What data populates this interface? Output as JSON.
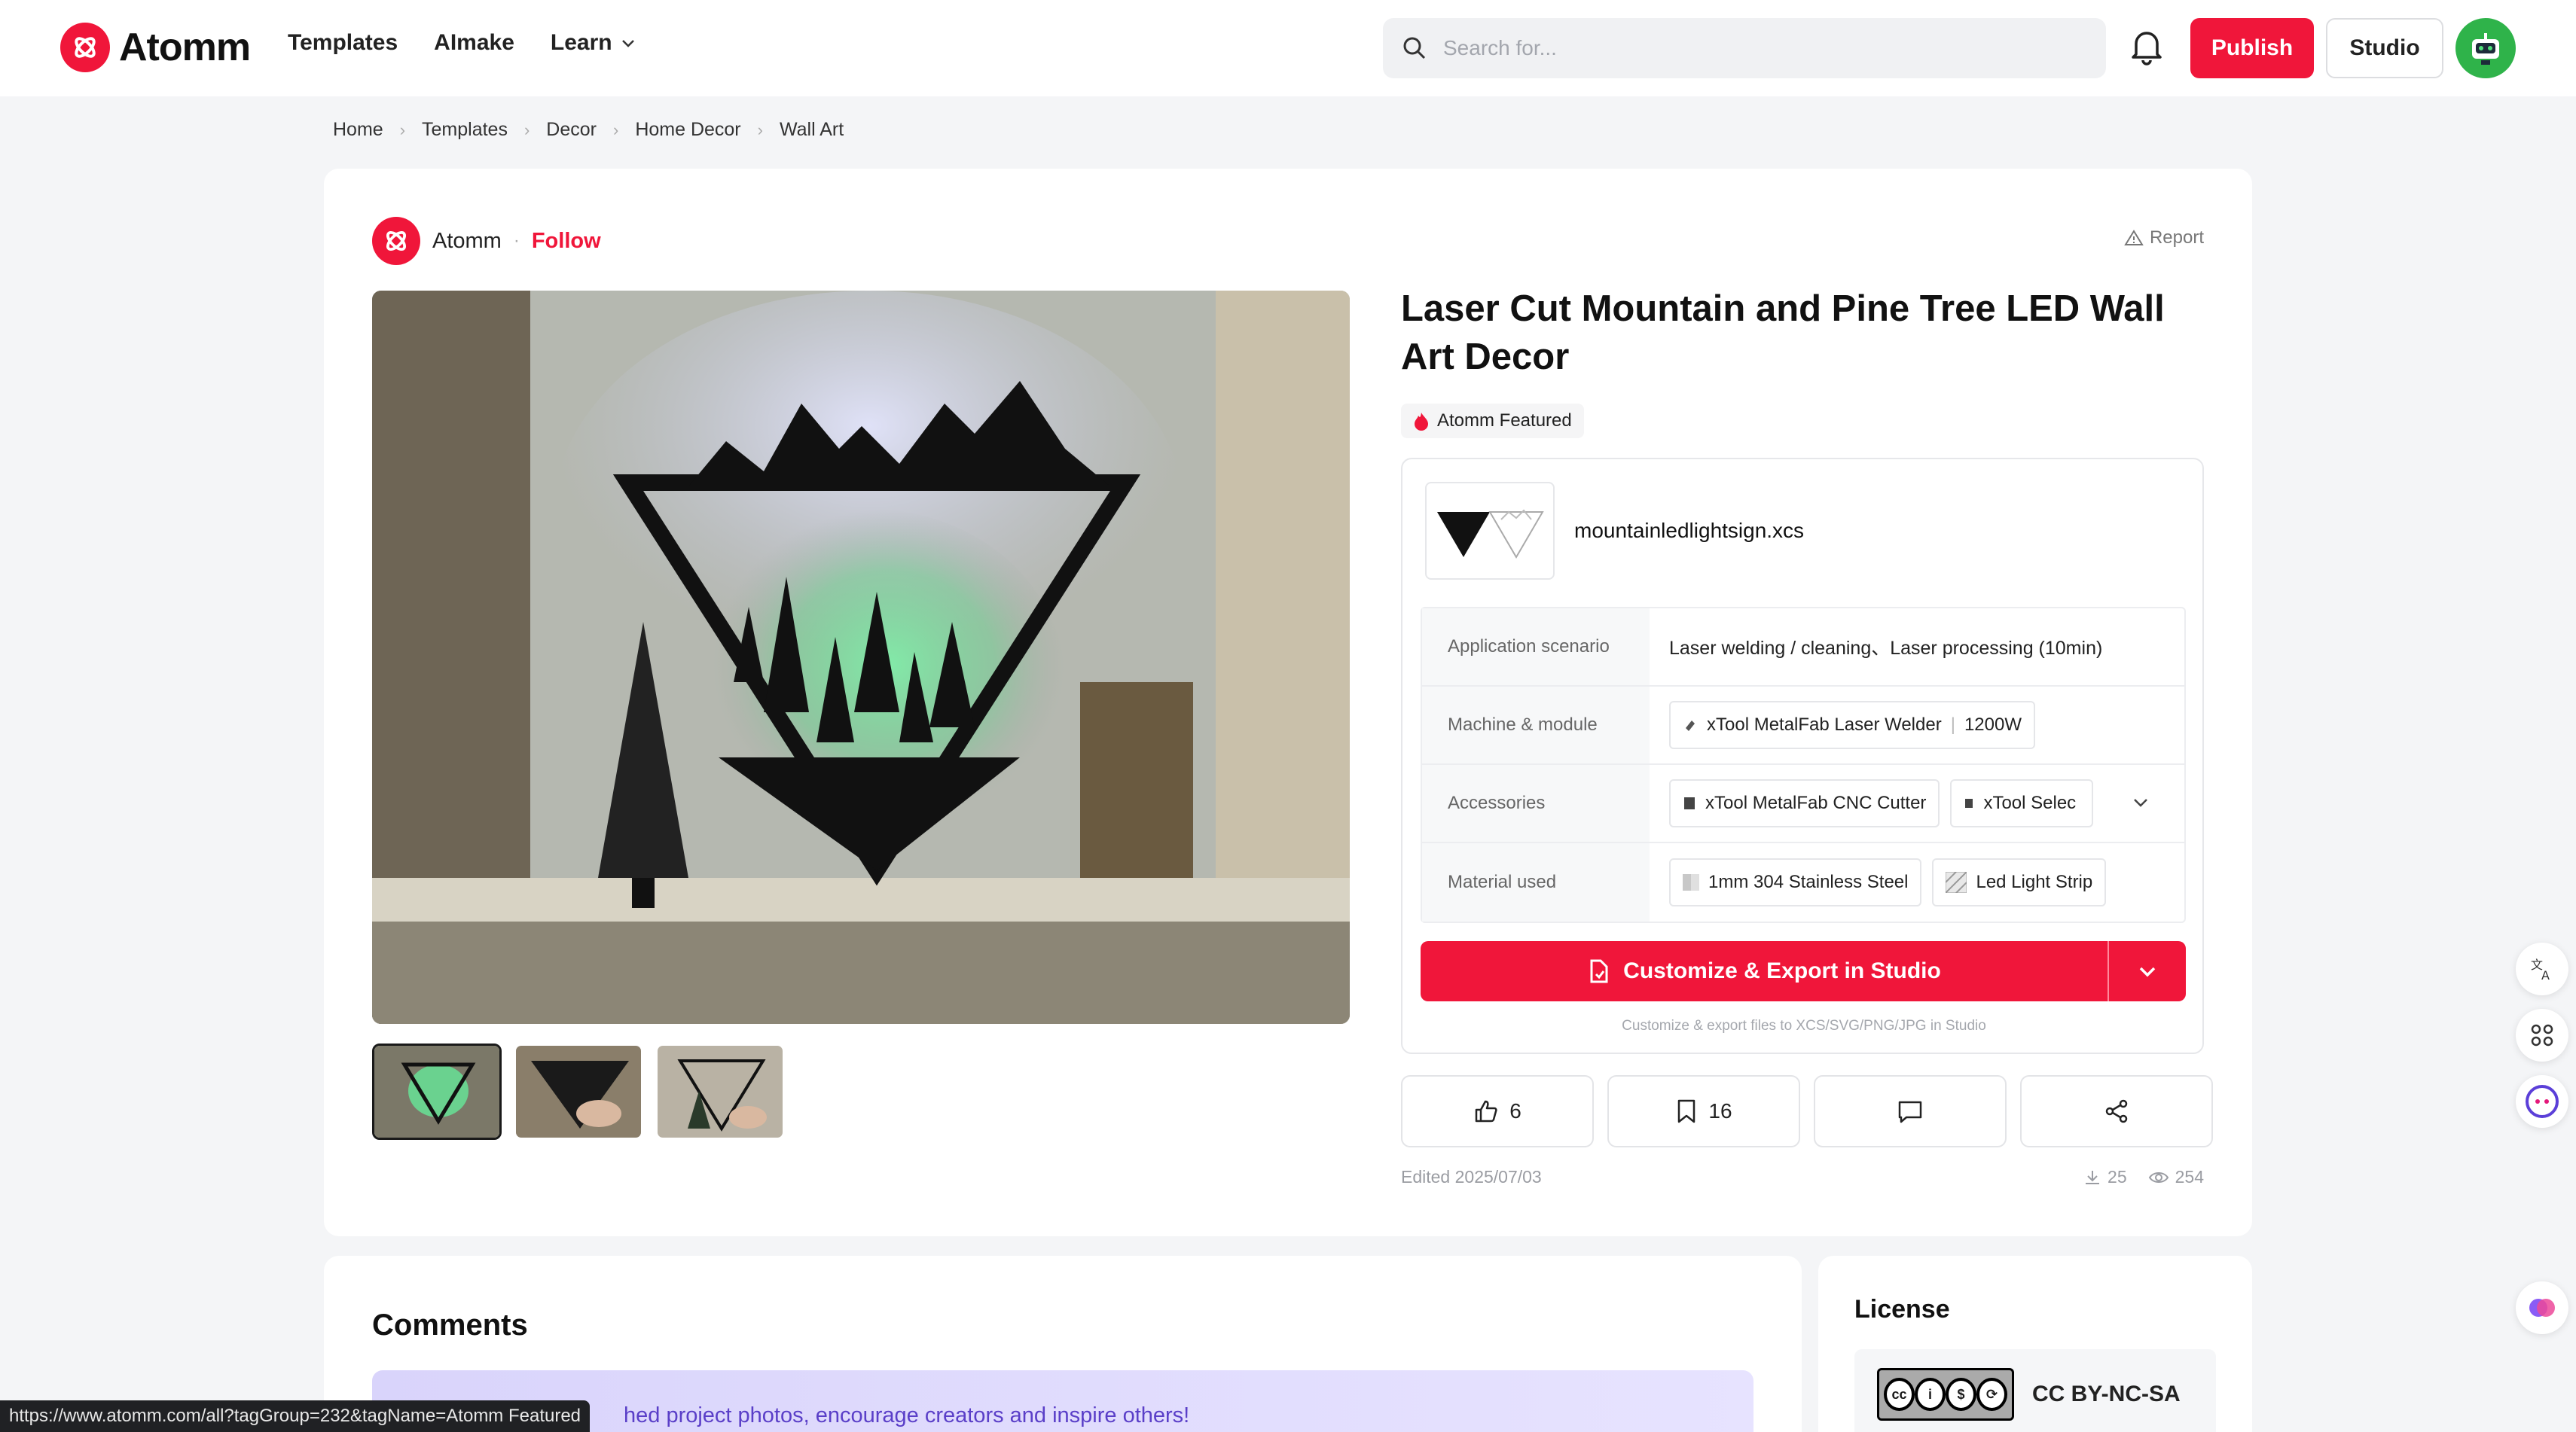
{
  "brand": {
    "name": "Atomm",
    "accent": "#f0163a"
  },
  "nav": {
    "templates": "Templates",
    "aimake": "AImake",
    "learn": "Learn"
  },
  "search": {
    "placeholder": "Search for..."
  },
  "header_actions": {
    "publish": "Publish",
    "studio": "Studio"
  },
  "breadcrumb": [
    "Home",
    "Templates",
    "Decor",
    "Home Decor",
    "Wall Art"
  ],
  "author": {
    "name": "Atomm",
    "follow": "Follow"
  },
  "report": "Report",
  "project": {
    "title": "Laser Cut Mountain and Pine Tree LED Wall Art Decor",
    "badge": "Atomm Featured",
    "file_name": "mountainledlightsign.xcs"
  },
  "specs": {
    "application_label": "Application scenario",
    "application_value": "Laser welding / cleaning、Laser processing (10min)",
    "machine_label": "Machine & module",
    "machine_name": "xTool MetalFab Laser Welder",
    "machine_module": "1200W",
    "accessories_label": "Accessories",
    "accessories": [
      "xTool MetalFab CNC Cutter",
      "xTool Selec"
    ],
    "material_label": "Material used",
    "materials": [
      "1mm 304 Stainless Steel",
      "Led Light Strip"
    ]
  },
  "cta": {
    "label": "Customize & Export in Studio",
    "note": "Customize & export files to XCS/SVG/PNG/JPG in Studio"
  },
  "actions": {
    "likes": "6",
    "bookmarks": "16"
  },
  "meta": {
    "edited": "Edited 2025/07/03",
    "downloads": "25",
    "views": "254"
  },
  "comments": {
    "title": "Comments",
    "banner": "hed project photos, encourage creators and inspire others!"
  },
  "license": {
    "title": "License",
    "name": "CC BY-NC-SA"
  },
  "status_url": "https://www.atomm.com/all?tagGroup=232&tagName=Atomm Featured"
}
